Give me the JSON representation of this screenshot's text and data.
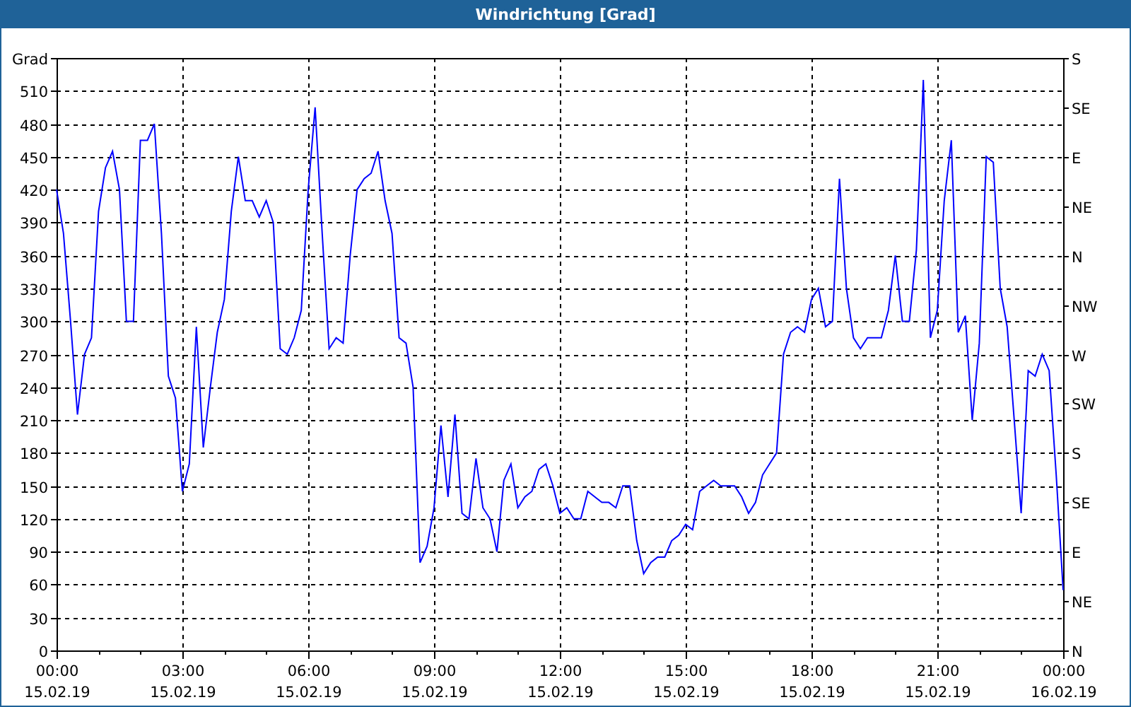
{
  "window": {
    "title": "Windrichtung [Grad]"
  },
  "chart_data": {
    "type": "line",
    "grid": true,
    "ylim": [
      0,
      540
    ],
    "categories": [
      "00:00\n15.02.19",
      null,
      null,
      null,
      null,
      null,
      null,
      null,
      null,
      null,
      null,
      null,
      null,
      null,
      null,
      null,
      null,
      null,
      "03:00\n15.02.19",
      null,
      null,
      null,
      null,
      null,
      null,
      null,
      null,
      null,
      null,
      null,
      null,
      null,
      null,
      null,
      null,
      null,
      "06:00\n15.02.19",
      null,
      null,
      null,
      null,
      null,
      null,
      null,
      null,
      null,
      null,
      null,
      null,
      null,
      null,
      null,
      null,
      null,
      "09:00\n15.02.19",
      null,
      null,
      null,
      null,
      null,
      null,
      null,
      null,
      null,
      null,
      null,
      null,
      null,
      null,
      null,
      null,
      null,
      "12:00\n15.02.19",
      null,
      null,
      null,
      null,
      null,
      null,
      null,
      null,
      null,
      null,
      null,
      null,
      null,
      null,
      null,
      null,
      null,
      "15:00\n15.02.19",
      null,
      null,
      null,
      null,
      null,
      null,
      null,
      null,
      null,
      null,
      null,
      null,
      null,
      null,
      null,
      null,
      null,
      "18:00\n15.02.19",
      null,
      null,
      null,
      null,
      null,
      null,
      null,
      null,
      null,
      null,
      null,
      null,
      null,
      null,
      null,
      null,
      null,
      "21:00\n15.02.19",
      null,
      null,
      null,
      null,
      null,
      null,
      null,
      null,
      null,
      null,
      null,
      null,
      null,
      null,
      null,
      null,
      null,
      "00:00\n16.02.19"
    ],
    "yticks": [
      0,
      30,
      60,
      90,
      120,
      150,
      180,
      210,
      240,
      270,
      300,
      330,
      360,
      390,
      420,
      450,
      480,
      510,
      {
        "value": 540,
        "label": "Grad"
      }
    ],
    "series": [
      {
        "color": "#0000ff",
        "values": [
          420,
          380,
          300,
          215,
          270,
          285,
          400,
          440,
          455,
          420,
          300,
          300,
          465,
          465,
          480,
          380,
          250,
          230,
          145,
          170,
          295,
          185,
          240,
          290,
          320,
          400,
          450,
          410,
          410,
          395,
          410,
          390,
          275,
          270,
          285,
          310,
          420,
          495,
          380,
          275,
          285,
          280,
          360,
          420,
          430,
          435,
          455,
          410,
          380,
          285,
          280,
          240,
          80,
          95,
          130,
          205,
          140,
          215,
          125,
          120,
          175,
          130,
          120,
          90,
          155,
          170,
          130,
          140,
          145,
          165,
          170,
          150,
          125,
          130,
          120,
          120,
          145,
          140,
          135,
          135,
          130,
          150,
          150,
          100,
          70,
          80,
          85,
          85,
          100,
          105,
          115,
          110,
          145,
          150,
          155,
          150,
          150,
          150,
          140,
          125,
          135,
          160,
          170,
          180,
          270,
          290,
          295,
          290,
          320,
          330,
          295,
          300,
          430,
          330,
          285,
          275,
          285,
          285,
          285,
          310,
          360,
          300,
          300,
          365,
          520,
          285,
          310,
          410,
          465,
          290,
          305,
          210,
          280,
          450,
          445,
          330,
          295,
          210,
          125,
          255,
          250,
          270,
          255,
          160,
          55
        ]
      }
    ]
  },
  "right_axis": {
    "labels": [
      "S",
      "SE",
      "E",
      "NE",
      "N",
      "NW",
      "W",
      "SW",
      "S",
      "SE",
      "E",
      "NE",
      "N"
    ]
  }
}
